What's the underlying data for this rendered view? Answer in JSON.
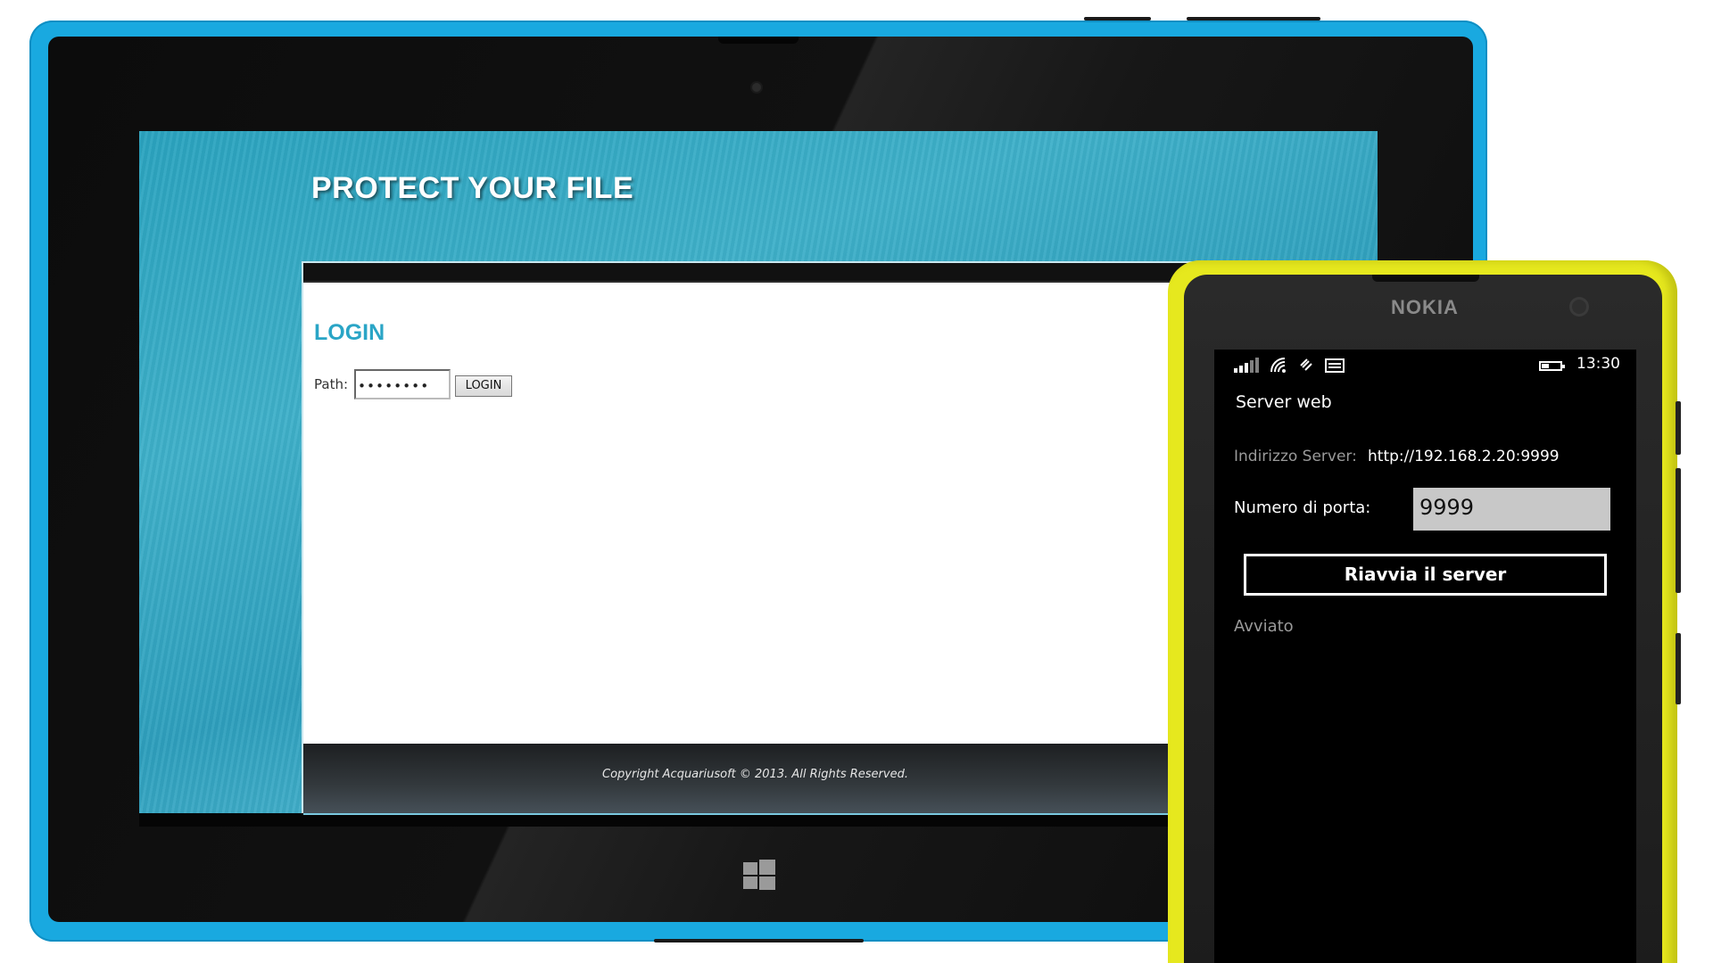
{
  "tablet": {
    "web": {
      "title": "PROTECT YOUR FILE",
      "login_heading": "LOGIN",
      "path_label": "Path:",
      "path_value": "••••••••",
      "login_button": "LOGIN",
      "footer": "Copyright Acquariusoft © 2013. All Rights Reserved."
    }
  },
  "phone": {
    "brand": "NOKIA",
    "status": {
      "time": "13:30",
      "battery_level": 0.45,
      "icons": [
        "signal-icon",
        "wifi-icon",
        "data-sync-icon",
        "message-icon"
      ]
    },
    "app": {
      "title": "Server web",
      "address_label": "Indirizzo Server:",
      "address_value": "http://192.168.2.20:9999",
      "port_label": "Numero di porta:",
      "port_value": "9999",
      "restart_button": "Riavvia il server",
      "status": "Avviato"
    }
  },
  "colors": {
    "tablet_frame": "#19a9e0",
    "phone_body": "#e6e81e",
    "accent": "#2aa5c6"
  }
}
